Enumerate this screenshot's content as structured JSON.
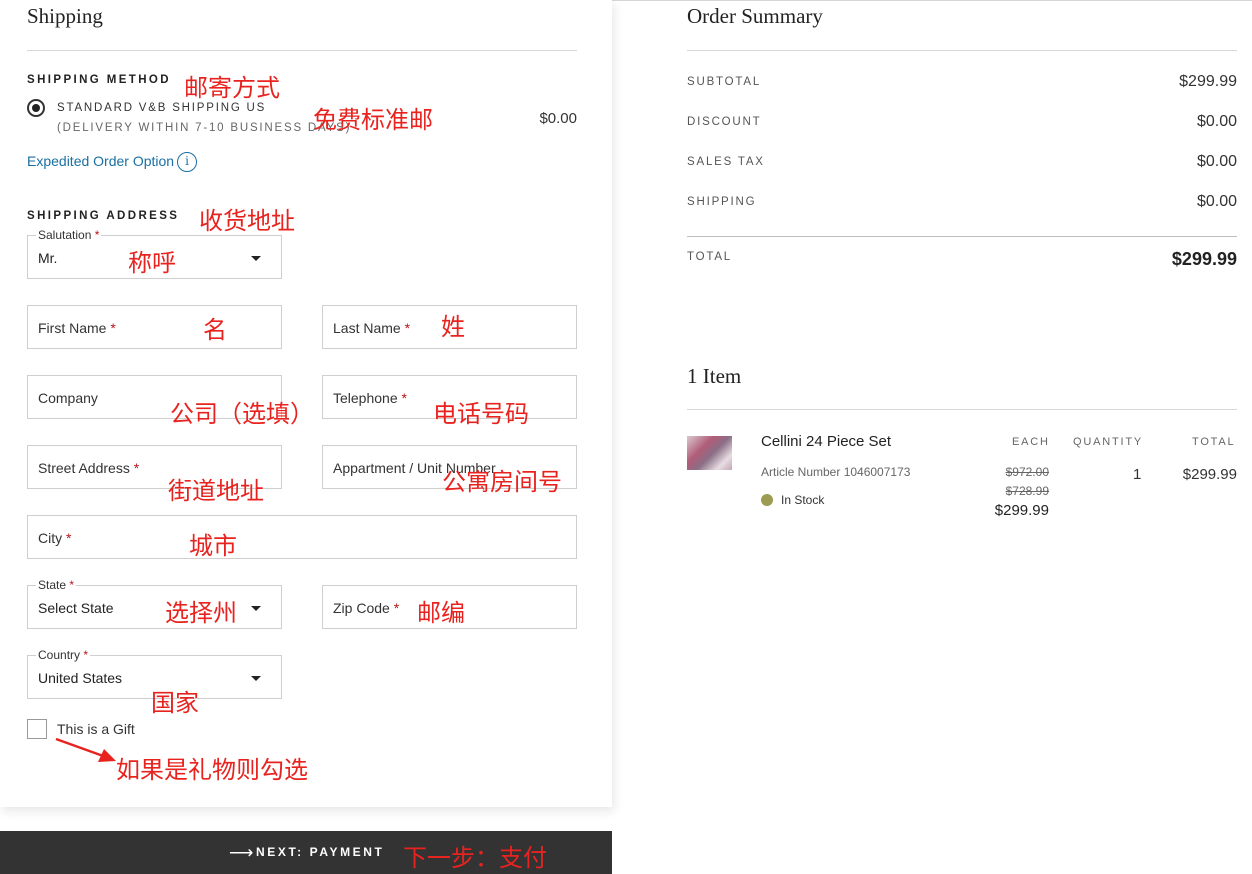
{
  "shipping": {
    "title": "Shipping",
    "method_heading": "SHIPPING METHOD",
    "method_option_name": "STANDARD V&B SHIPPING US",
    "method_option_detail": "(DELIVERY WITHIN 7-10 BUSINESS DAYS)",
    "method_option_price": "$0.00",
    "expedited_link": "Expedited Order Option",
    "info_icon_glyph": "i",
    "address_heading": "SHIPPING ADDRESS"
  },
  "form": {
    "salutation_label": "Salutation",
    "salutation_value": "Mr.",
    "first_name": "First Name",
    "last_name": "Last Name",
    "company": "Company",
    "telephone": "Telephone",
    "street": "Street Address",
    "apartment": "Appartment / Unit Number",
    "city": "City",
    "state_label": "State",
    "state_value": "Select State",
    "zip": "Zip Code",
    "country_label": "Country",
    "country_value": "United States",
    "required_mark": "*",
    "gift_label": "This is a Gift"
  },
  "next_button": {
    "label": "NEXT: PAYMENT",
    "arrow": "⟶"
  },
  "annotations": {
    "method": "邮寄方式",
    "free": "免费标准邮",
    "address": "收货地址",
    "salutation": "称呼",
    "first_name": "名",
    "last_name": "姓",
    "company": "公司（选填）",
    "telephone": "电话号码",
    "street": "街道地址",
    "apartment": "公寓房间号",
    "city": "城市",
    "state": "选择州",
    "zip": "邮编",
    "country": "国家",
    "gift": "如果是礼物则勾选",
    "next": "下一步：支付"
  },
  "summary": {
    "title": "Order Summary",
    "rows": [
      {
        "label": "SUBTOTAL",
        "value": "$299.99"
      },
      {
        "label": "DISCOUNT",
        "value": "$0.00"
      },
      {
        "label": "SALES TAX",
        "value": "$0.00"
      },
      {
        "label": "SHIPPING",
        "value": "$0.00"
      }
    ],
    "total_label": "TOTAL",
    "total_value": "$299.99"
  },
  "items": {
    "title": "1 Item",
    "col_each": "EACH",
    "col_quantity": "QUANTITY",
    "col_total": "TOTAL",
    "product": {
      "name": "Cellini 24 Piece Set",
      "article": "Article Number 1046007173",
      "stock": "In Stock",
      "price_original": "$972.00",
      "price_previous": "$728.99",
      "price_current": "$299.99",
      "quantity": "1",
      "total": "$299.99"
    }
  },
  "colors": {
    "accent_link": "#1a6fa3",
    "required": "#b8141a",
    "annotation": "#e8231f",
    "button_bg": "#333333",
    "stock_dot": "#9c9b52"
  }
}
